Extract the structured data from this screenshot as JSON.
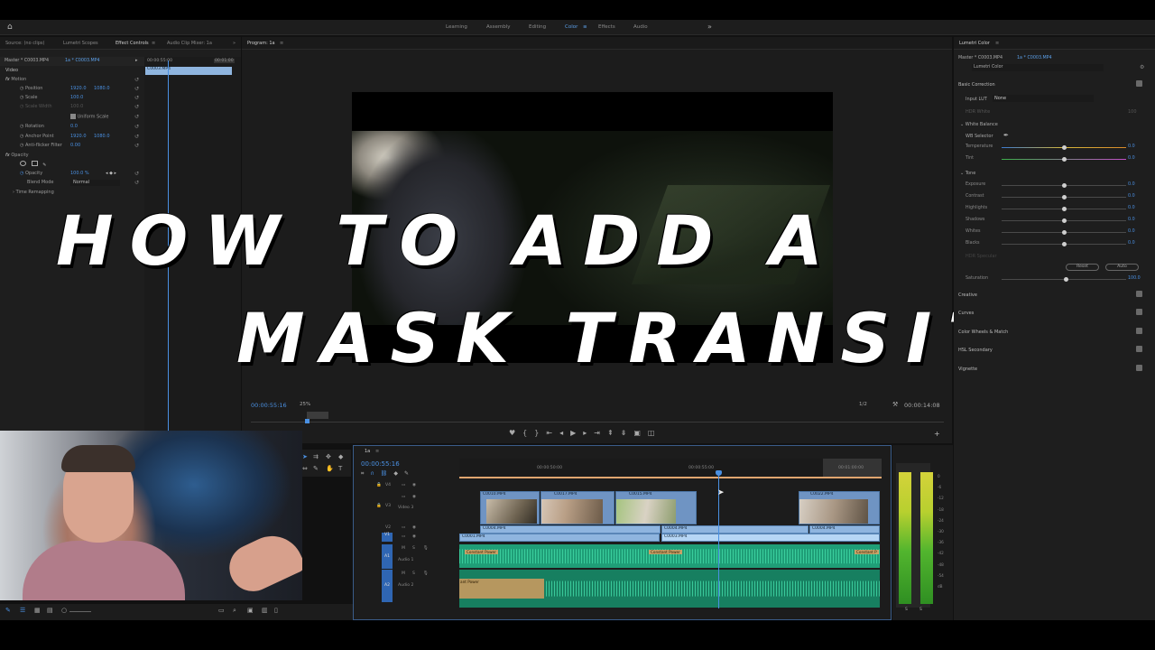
{
  "workspaces": [
    "Learning",
    "Assembly",
    "Editing",
    "Color",
    "Effects",
    "Audio"
  ],
  "active_workspace": "Color",
  "source_panel": {
    "tabs": [
      "Source: (no clips)",
      "Lumetri Scopes",
      "Effect Controls",
      "Audio Clip Mixer: 1a"
    ],
    "active_tab": "Effect Controls",
    "master_label": "Master * C0003.MP4",
    "sequence_label": "1a * C0003.MP4",
    "mini_timecode_start": "00:00:55:00",
    "mini_timecode_end": "00:01:00",
    "mini_clip_label": "C0003.MP4",
    "rows": [
      {
        "label": "Video",
        "v1": "",
        "v2": ""
      },
      {
        "label": "Motion",
        "v1": "",
        "v2": ""
      },
      {
        "label": "Position",
        "v1": "1920.0",
        "v2": "1080.0"
      },
      {
        "label": "Scale",
        "v1": "100.0",
        "v2": ""
      },
      {
        "label": "Scale Width",
        "v1": "100.0",
        "v2": ""
      },
      {
        "label": "Uniform Scale",
        "v1": "",
        "v2": ""
      },
      {
        "label": "Rotation",
        "v1": "0.0",
        "v2": ""
      },
      {
        "label": "Anchor Point",
        "v1": "1920.0",
        "v2": "1080.0"
      },
      {
        "label": "Anti-flicker Filter",
        "v1": "0.00",
        "v2": ""
      },
      {
        "label": "Opacity",
        "v1": "",
        "v2": ""
      },
      {
        "label": "Opacity",
        "v1": "100.0 %",
        "v2": ""
      },
      {
        "label": "Blend Mode",
        "v1": "Normal",
        "v2": ""
      },
      {
        "label": "Time Remapping",
        "v1": "",
        "v2": ""
      }
    ]
  },
  "program": {
    "tab": "Program: 1a",
    "timecode": "00:00:55:16",
    "zoom": "25%",
    "resolution": "1/2",
    "duration": "00:00:14:08"
  },
  "overlay_title": {
    "line1": "HOW TO ADD A",
    "line2": "MASK TRANSITION"
  },
  "timeline": {
    "tab": "1a",
    "timecode": "00:00:55:16",
    "ruler": [
      "00:00:50:00",
      "00:00:55:00",
      "00:01:00:00"
    ],
    "tracks": [
      {
        "id": "V4",
        "name": ""
      },
      {
        "id": "V3",
        "name": "Video 3"
      },
      {
        "id": "V2",
        "name": ""
      },
      {
        "id": "V1",
        "name": ""
      },
      {
        "id": "A1",
        "name": "Audio 1"
      },
      {
        "id": "A2",
        "name": "Audio 2"
      }
    ],
    "v3_clips": [
      "C0010.MP4",
      "C0017.MP4",
      "C0015.MP4",
      "C0022.MP4"
    ],
    "v2_clips": [
      "C0004.MP4",
      "C0004.MP4",
      "C0004.MP4"
    ],
    "v1_clips": [
      "C0001.MP4",
      "C0003.MP4"
    ],
    "audio_labels": [
      "Constant Power",
      "Constant Power",
      "Constant P",
      "ant Power"
    ],
    "meter_scale": [
      "0",
      "-6",
      "-12",
      "-18",
      "-24",
      "-30",
      "-36",
      "-42",
      "-48",
      "-54",
      "dB"
    ],
    "meter_bottom": [
      "S",
      "S"
    ]
  },
  "lumetri": {
    "tab": "Lumetri Color",
    "master_label": "Master * C0003.MP4",
    "sequence_label": "1a * C0003.MP4",
    "effect_name": "Lumetri Color",
    "basic_correction": "Basic Correction",
    "input_lut_label": "Input LUT",
    "input_lut_value": "None",
    "hdr_white_label": "HDR White",
    "hdr_white_value": "100",
    "white_balance": "White Balance",
    "wb_selector": "WB Selector",
    "tone": "Tone",
    "sliders": [
      {
        "label": "Temperature",
        "value": "0.0",
        "pos": 0.5
      },
      {
        "label": "Tint",
        "value": "0.0",
        "pos": 0.5
      },
      {
        "label": "Exposure",
        "value": "0.0",
        "pos": 0.5
      },
      {
        "label": "Contrast",
        "value": "0.0",
        "pos": 0.5
      },
      {
        "label": "Highlights",
        "value": "0.0",
        "pos": 0.5
      },
      {
        "label": "Shadows",
        "value": "0.0",
        "pos": 0.5
      },
      {
        "label": "Whites",
        "value": "0.0",
        "pos": 0.5
      },
      {
        "label": "Blacks",
        "value": "0.0",
        "pos": 0.5
      }
    ],
    "hdr_specular": "HDR Specular",
    "reset_label": "Reset",
    "auto_label": "Auto",
    "saturation_label": "Saturation",
    "saturation_value": "100.0",
    "sections": [
      "Creative",
      "Curves",
      "Color Wheels & Match",
      "HSL Secondary",
      "Vignette"
    ]
  }
}
